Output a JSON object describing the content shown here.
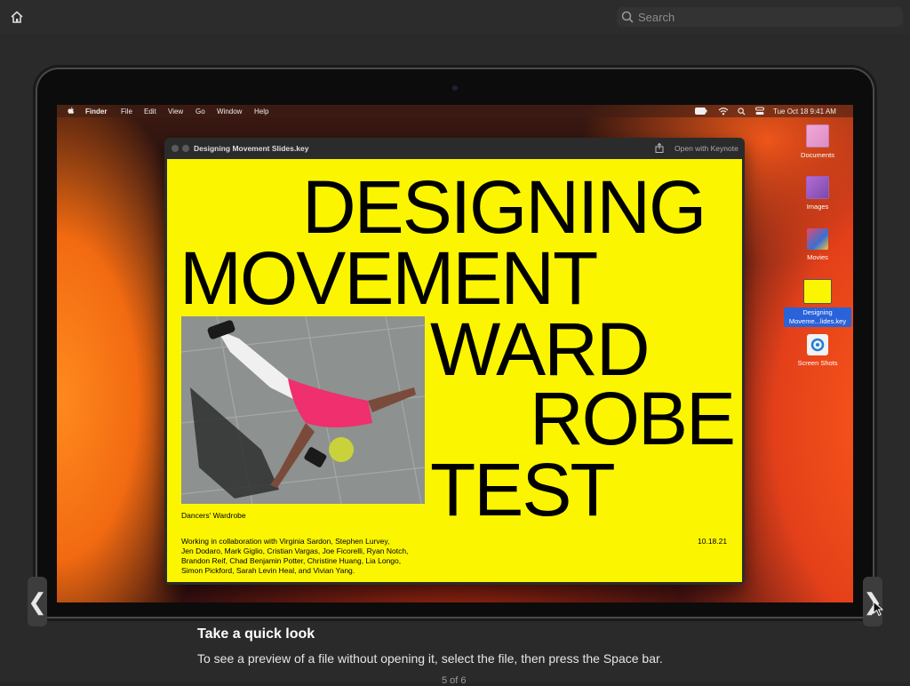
{
  "toolbar": {
    "home_icon": "home-icon",
    "search_placeholder": "Search",
    "search_icon": "search-icon"
  },
  "screen": {
    "menubar": {
      "apple_icon": "apple-icon",
      "items": [
        "Finder",
        "File",
        "Edit",
        "View",
        "Go",
        "Window",
        "Help"
      ],
      "status_icons": [
        "battery-icon",
        "wifi-icon",
        "search-icon",
        "control-center-icon"
      ],
      "datetime": "Tue Oct 18  9:41 AM"
    },
    "desktop_icons": [
      {
        "label": "Documents"
      },
      {
        "label": "Images"
      },
      {
        "label": "Movies"
      },
      {
        "label": "Designing Moveme...lides.key"
      },
      {
        "label": "Screen Shots"
      }
    ],
    "quicklook": {
      "title": "Designing Movement Slides.key",
      "open_with": "Open with Keynote",
      "share_icon": "share-icon",
      "slide": {
        "line1": "DESIGNING",
        "line2": "MOVEMENT",
        "line3": "WARD",
        "line4": "ROBE",
        "line5": "TEST",
        "caption": "Dancers' Wardrobe",
        "credits1": "Working in collaboration with Virginia Sardon, Stephen Lurvey,",
        "credits2": "Jen Dodaro, Mark Giglio, Cristian Vargas, Joe Ficorelli, Ryan Notch,",
        "credits3": "Brandon Reif, Chad Benjamin Potter, Christine Huang, Lia Longo,",
        "credits4": "Simon Pickford, Sarah Levin Heal, and Vivian Yang.",
        "date": "10.18.21"
      }
    }
  },
  "nav": {
    "prev_icon": "chevron-left-icon",
    "next_icon": "chevron-right-icon",
    "prev_glyph": "❮",
    "next_glyph": "❯"
  },
  "info": {
    "title": "Take a quick look",
    "description": "To see a preview of a file without opening it, select the file, then press the Space bar.",
    "pager": "5 of 6"
  },
  "colors": {
    "slide_bg": "#fbf600",
    "background": "#262626",
    "selection": "#2a62d9"
  }
}
